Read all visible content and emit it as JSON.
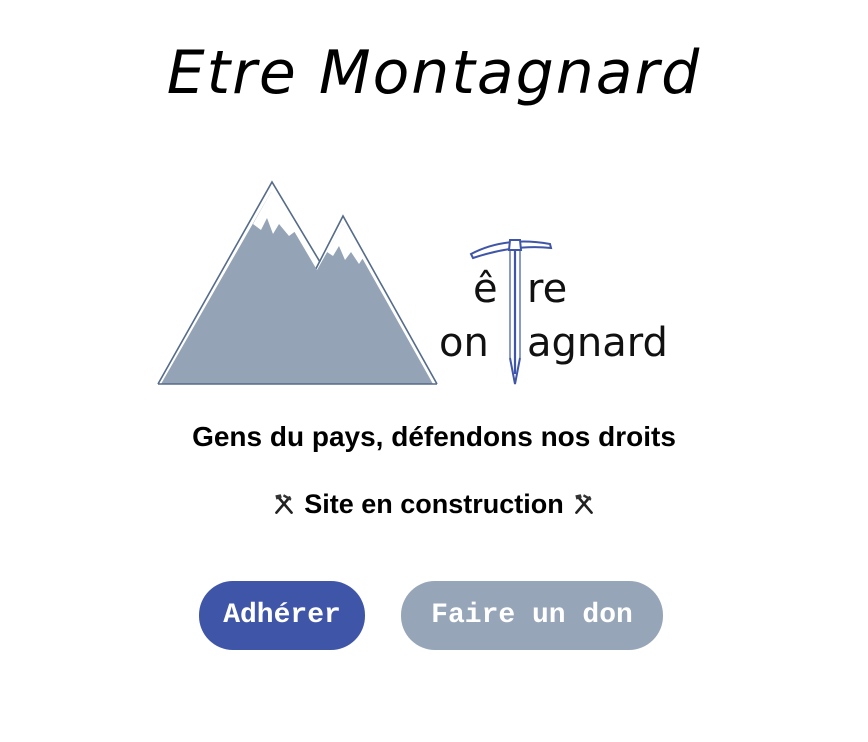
{
  "header": {
    "title": "Etre Montagnard"
  },
  "logo": {
    "line1": "être",
    "line2": "montagnard",
    "line1_visible_a": "ê",
    "line1_visible_b": "re",
    "line2_visible_a": "on",
    "line2_visible_b": "agnard",
    "icon": "mountain-ice-axe-logo",
    "colors": {
      "mountain": "#94a3b6",
      "axe": "#3f55a8"
    }
  },
  "tagline": "Gens du pays, défendons nos droits",
  "status": {
    "text": "Site en construction",
    "icon": "hammer-pick-icon"
  },
  "actions": {
    "join_label": "Adhérer",
    "donate_label": "Faire un don"
  },
  "colors": {
    "primary": "#3f55a8",
    "secondary": "#96a5b8"
  }
}
